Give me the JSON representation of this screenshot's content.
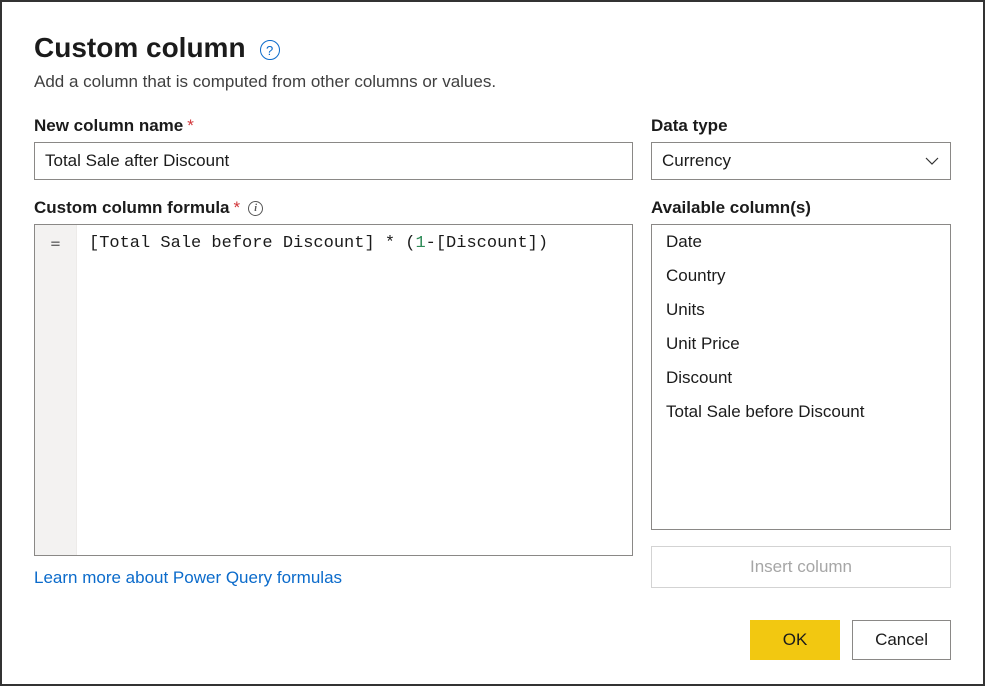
{
  "dialog": {
    "title": "Custom column",
    "subtitle": "Add a column that is computed from other columns or values."
  },
  "columnName": {
    "label": "New column name",
    "value": "Total Sale after Discount"
  },
  "dataType": {
    "label": "Data type",
    "value": "Currency"
  },
  "formula": {
    "label": "Custom column formula",
    "gutter": "=",
    "parts": {
      "p1": "[Total Sale before Discount] * (",
      "p2": "1",
      "p3": "-[Discount])"
    }
  },
  "availableColumns": {
    "label": "Available column(s)",
    "items": [
      "Date",
      "Country",
      "Units",
      "Unit Price",
      "Discount",
      "Total Sale before Discount"
    ]
  },
  "insertButton": "Insert column",
  "learnMore": "Learn more about Power Query formulas",
  "buttons": {
    "ok": "OK",
    "cancel": "Cancel"
  }
}
